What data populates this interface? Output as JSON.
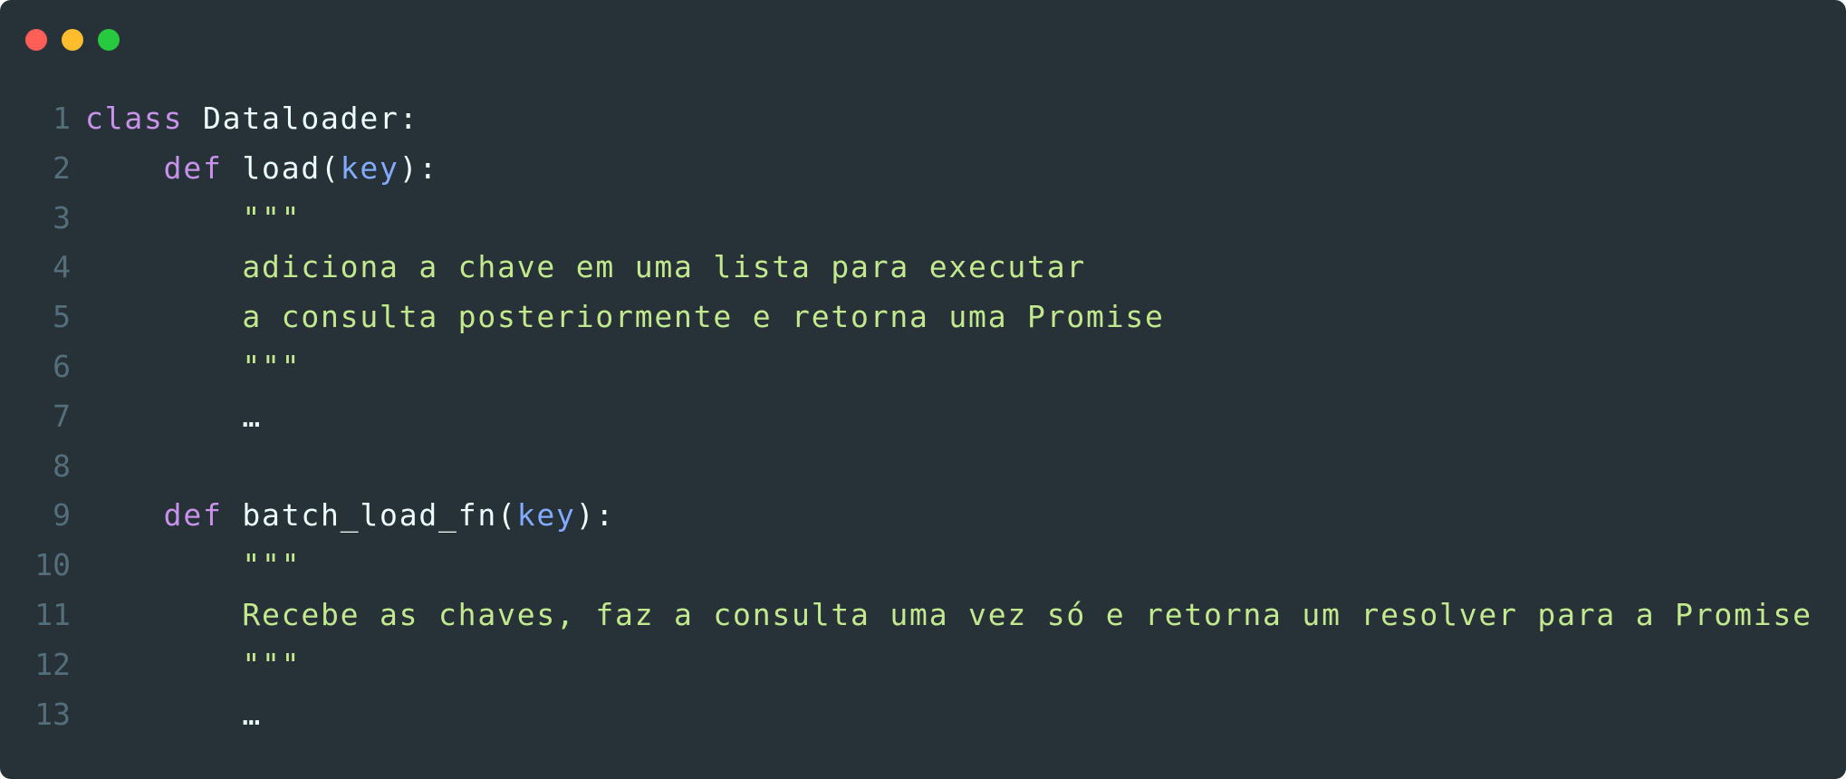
{
  "window": {
    "buttons": [
      {
        "name": "close",
        "color": "#ff5f56"
      },
      {
        "name": "minimize",
        "color": "#ffbd2e"
      },
      {
        "name": "maximize",
        "color": "#27c93f"
      }
    ]
  },
  "colors": {
    "background": "#263238",
    "keyword": "#c792ea",
    "parameter": "#82aaff",
    "string": "#c3e88d",
    "text": "#eeffff",
    "line_number": "#546e7a"
  },
  "code": {
    "lines": [
      {
        "n": "1",
        "tokens": [
          {
            "t": "class",
            "c": "kw"
          },
          {
            "t": " Dataloader:",
            "c": "plain"
          }
        ]
      },
      {
        "n": "2",
        "tokens": [
          {
            "t": "    ",
            "c": "plain"
          },
          {
            "t": "def",
            "c": "kw"
          },
          {
            "t": " load(",
            "c": "plain"
          },
          {
            "t": "key",
            "c": "param"
          },
          {
            "t": "):",
            "c": "plain"
          }
        ]
      },
      {
        "n": "3",
        "tokens": [
          {
            "t": "        \"\"\"",
            "c": "str"
          }
        ]
      },
      {
        "n": "4",
        "tokens": [
          {
            "t": "        adiciona a chave em uma lista para executar",
            "c": "str"
          }
        ]
      },
      {
        "n": "5",
        "tokens": [
          {
            "t": "        a consulta posteriormente e retorna uma Promise",
            "c": "str"
          }
        ]
      },
      {
        "n": "6",
        "tokens": [
          {
            "t": "        \"\"\"",
            "c": "str"
          }
        ]
      },
      {
        "n": "7",
        "tokens": [
          {
            "t": "        …",
            "c": "plain"
          }
        ]
      },
      {
        "n": "8",
        "tokens": []
      },
      {
        "n": "9",
        "tokens": [
          {
            "t": "    ",
            "c": "plain"
          },
          {
            "t": "def",
            "c": "kw"
          },
          {
            "t": " batch_load_fn(",
            "c": "plain"
          },
          {
            "t": "key",
            "c": "param"
          },
          {
            "t": "):",
            "c": "plain"
          }
        ]
      },
      {
        "n": "10",
        "tokens": [
          {
            "t": "        \"\"\"",
            "c": "str"
          }
        ]
      },
      {
        "n": "11",
        "tokens": [
          {
            "t": "        Recebe as chaves, faz a consulta uma vez só e retorna um resolver para a Promise",
            "c": "str"
          }
        ]
      },
      {
        "n": "12",
        "tokens": [
          {
            "t": "        \"\"\"",
            "c": "str"
          }
        ]
      },
      {
        "n": "13",
        "tokens": [
          {
            "t": "        …",
            "c": "plain"
          }
        ]
      }
    ]
  }
}
